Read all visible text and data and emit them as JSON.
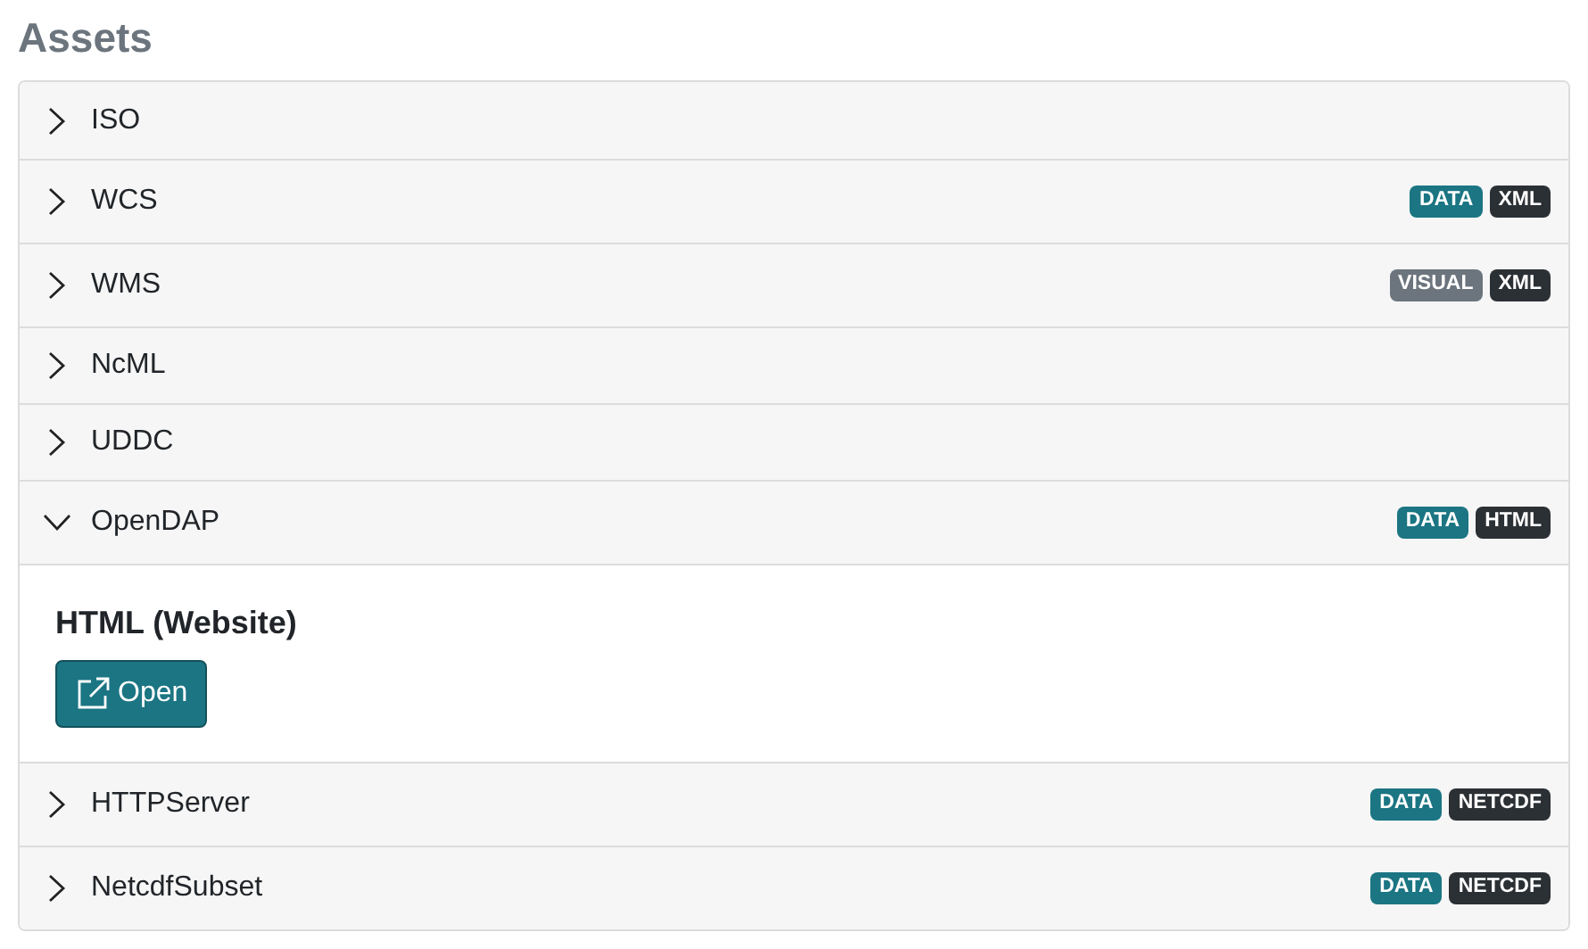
{
  "title": "Assets",
  "items": [
    {
      "label": "ISO",
      "expanded": false
    },
    {
      "label": "WCS",
      "expanded": false,
      "tags": [
        {
          "text": "DATA",
          "color": "#1b7583"
        },
        {
          "text": "XML",
          "color": "#2b3035"
        }
      ]
    },
    {
      "label": "WMS",
      "expanded": false,
      "tags": [
        {
          "text": "VISUAL",
          "color": "#6c757d"
        },
        {
          "text": "XML",
          "color": "#2b3035"
        }
      ]
    },
    {
      "label": "NcML",
      "expanded": false
    },
    {
      "label": "UDDC",
      "expanded": false
    },
    {
      "label": "OpenDAP",
      "expanded": true,
      "tags": [
        {
          "text": "DATA",
          "color": "#1b7583"
        },
        {
          "text": "HTML",
          "color": "#2b3035"
        }
      ],
      "body": {
        "heading": "HTML (Website)",
        "button": "Open"
      }
    },
    {
      "label": "HTTPServer",
      "expanded": false,
      "tags": [
        {
          "text": "DATA",
          "color": "#1b7583"
        },
        {
          "text": "NETCDF",
          "color": "#2b3035"
        }
      ]
    },
    {
      "label": "NetcdfSubset",
      "expanded": false,
      "tags": [
        {
          "text": "DATA",
          "color": "#1b7583"
        },
        {
          "text": "NETCDF",
          "color": "#2b3035"
        }
      ]
    }
  ]
}
